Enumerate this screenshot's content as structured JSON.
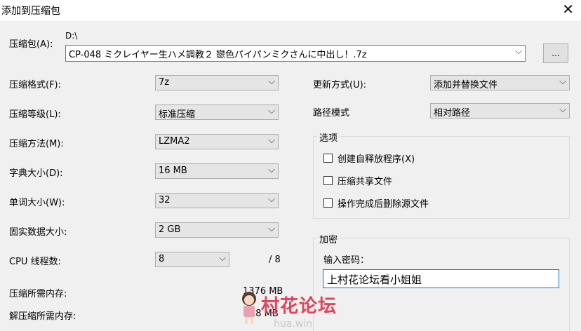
{
  "window": {
    "title": "添加到压缩包"
  },
  "archive": {
    "label": "压缩包(A):",
    "path": "D:\\",
    "name": "CP-048 ミクレイヤー生ハメ調教２ 戀色パイパンミクさんに中出し！.7z",
    "browse_label": "..."
  },
  "left": {
    "format": {
      "label": "压缩格式(F):",
      "value": "7z"
    },
    "level": {
      "label": "压缩等级(L):",
      "value": "标准压缩"
    },
    "method": {
      "label": "压缩方法(M):",
      "value": "LZMA2"
    },
    "dict": {
      "label": "字典大小(D):",
      "value": "16 MB"
    },
    "word": {
      "label": "单词大小(W):",
      "value": "32"
    },
    "solid": {
      "label": "固实数据大小:",
      "value": "2 GB"
    },
    "threads": {
      "label": "CPU 线程数:",
      "value": "8",
      "max": "/ 8"
    },
    "mem_compress": {
      "label": "压缩所需内存:",
      "value": "1376 MB"
    },
    "mem_decompress": {
      "label": "解压缩所需内存:",
      "value": "18 MB"
    }
  },
  "right": {
    "update": {
      "label": "更新方式(U):",
      "value": "添加并替换文件"
    },
    "pathmode": {
      "label": "路径模式",
      "value": "相对路径"
    },
    "options": {
      "title": "选项",
      "sfx": "创建自释放程序(X)",
      "shared": "压缩共享文件",
      "delete": "操作完成后删除源文件"
    },
    "encryption": {
      "title": "加密",
      "prompt": "输入密码：",
      "password": "上村花论坛看小姐姐"
    }
  },
  "watermark": {
    "text": "村花论坛",
    "url": "hua.win"
  },
  "icons": {
    "dropdown": "chevron-down-icon",
    "close": "close-icon"
  }
}
